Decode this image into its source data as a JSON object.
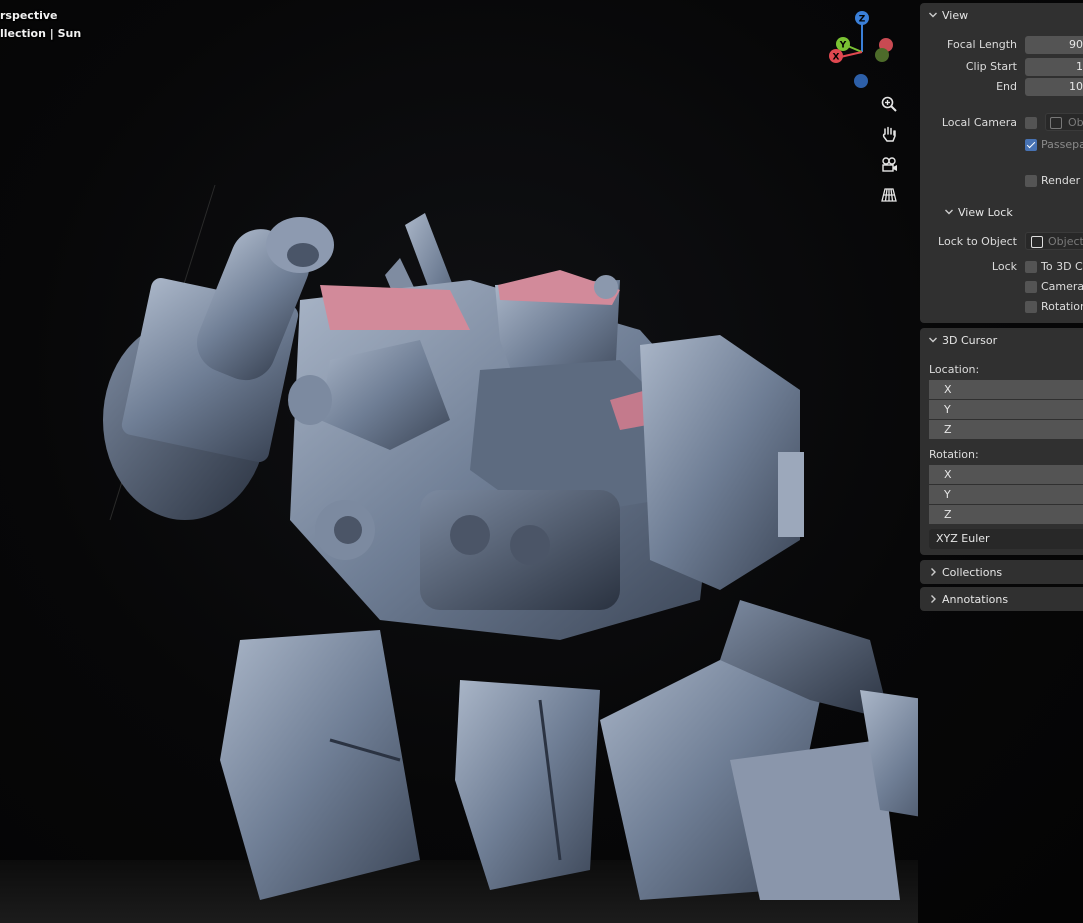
{
  "viewport": {
    "overlay_line1": "rspective",
    "overlay_line2": "llection | Sun",
    "gizmo": {
      "x_label": "X",
      "y_label": "Y",
      "z_label": "Z"
    },
    "nav_icons": [
      "zoom-icon",
      "hand-pan-icon",
      "camera-view-icon",
      "grid-projection-icon"
    ],
    "colors": {
      "x_axis": "#e04850",
      "y_axis": "#7ac233",
      "z_axis": "#3a7fd8",
      "robot_body": "#6f7e95",
      "robot_accent": "#d28a9a"
    }
  },
  "view_panel": {
    "title": "View",
    "focal_length_label": "Focal Length",
    "focal_length_value": "90",
    "clip_start_label": "Clip Start",
    "clip_start_value": "1",
    "clip_end_label": "End",
    "clip_end_value": "10",
    "local_camera_label": "Local Camera",
    "local_camera_field": "Ob",
    "passepartout_label": "Passepa",
    "render_label": "Render",
    "view_lock_title": "View Lock",
    "lock_to_object_label": "Lock to Object",
    "lock_to_object_field": "Object",
    "lock_label": "Lock",
    "to_3d_cursor_label": "To 3D C",
    "camera_label": "Camera",
    "rotation_label": "Rotation"
  },
  "cursor_panel": {
    "title": "3D Cursor",
    "location_label": "Location:",
    "location": [
      "X",
      "Y",
      "Z"
    ],
    "rotation_label": "Rotation:",
    "rotation": [
      "X",
      "Y",
      "Z"
    ],
    "rotation_mode": "XYZ Euler"
  },
  "collapsed_panels": {
    "collections": "Collections",
    "annotations": "Annotations"
  }
}
